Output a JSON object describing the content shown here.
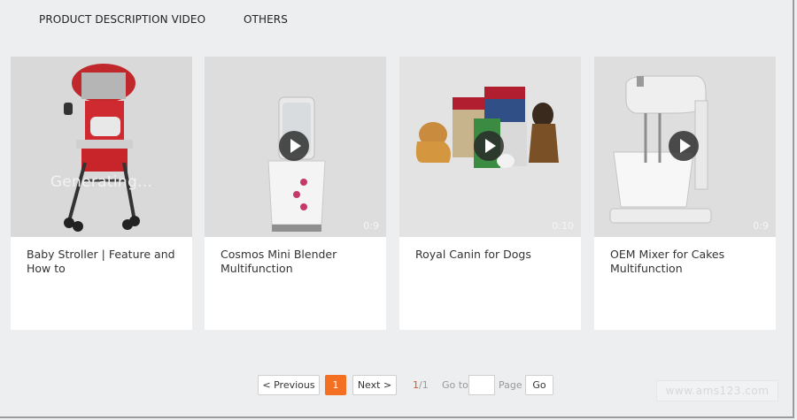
{
  "tabs": [
    {
      "label": "PRODUCT DESCRIPTION VIDEO"
    },
    {
      "label": "OTHERS"
    }
  ],
  "cards": [
    {
      "title": "Baby Stroller | Feature and How to",
      "status": "Generating...",
      "duration": ""
    },
    {
      "title": "Cosmos Mini Blender Multifunction",
      "status": "",
      "duration": "0:9"
    },
    {
      "title": "Royal Canin for Dogs",
      "status": "",
      "duration": "0:10"
    },
    {
      "title": "OEM Mixer for Cakes Multifunction",
      "status": "",
      "duration": "0:9"
    }
  ],
  "pagination": {
    "prev_label": "< Previous",
    "current_page": "1",
    "next_label": "Next >",
    "count_current": "1",
    "count_total": "/1",
    "goto_label": "Go to",
    "goto_value": "",
    "page_label": "Page",
    "go_label": "Go"
  },
  "watermark": "www.ams123.com",
  "colors": {
    "background": "#eceef0",
    "accent": "#f36f21"
  }
}
